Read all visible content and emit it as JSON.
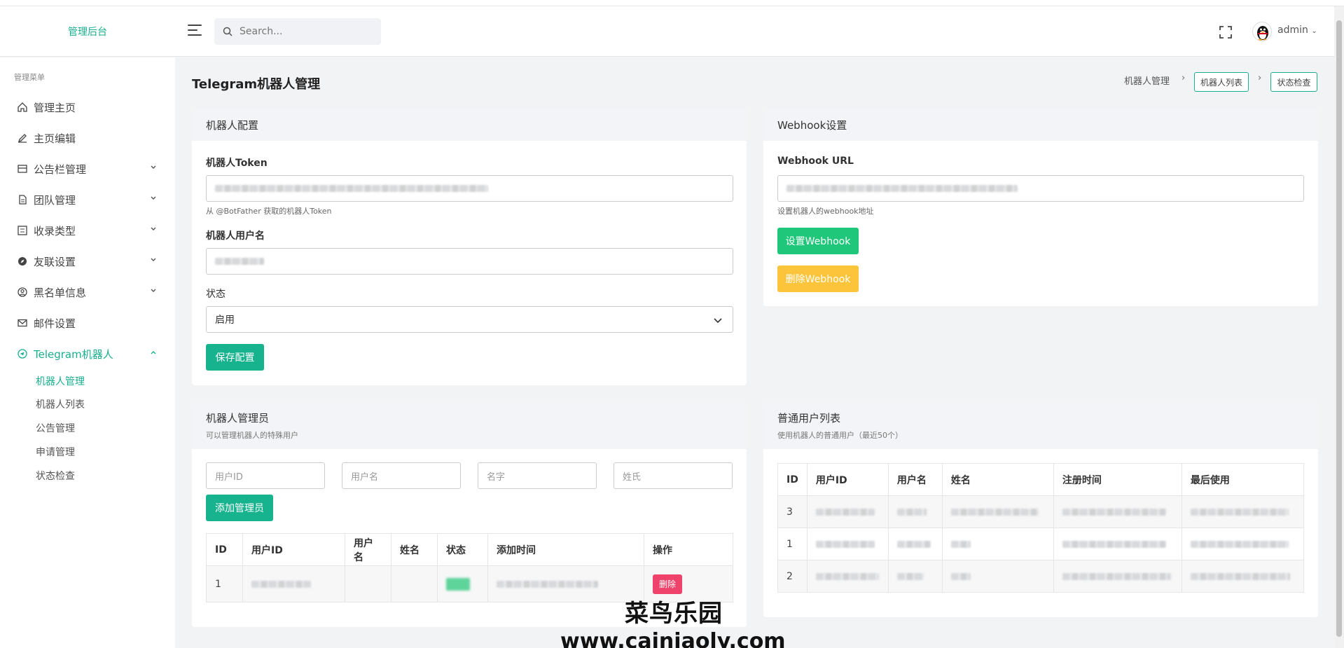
{
  "header": {
    "brand": "管理后台",
    "search_placeholder": "Search...",
    "user": "admin"
  },
  "sidebar": {
    "title": "管理菜单",
    "items": [
      {
        "label": "管理主页",
        "icon": "home-icon"
      },
      {
        "label": "主页编辑",
        "icon": "edit-icon"
      },
      {
        "label": "公告栏管理",
        "icon": "notice-icon"
      },
      {
        "label": "团队管理",
        "icon": "team-icon"
      },
      {
        "label": "收录类型",
        "icon": "category-icon"
      },
      {
        "label": "友联设置",
        "icon": "compass-icon"
      },
      {
        "label": "黑名单信息",
        "icon": "blacklist-icon"
      },
      {
        "label": "邮件设置",
        "icon": "mail-icon"
      },
      {
        "label": "Telegram机器人",
        "icon": "telegram-icon"
      }
    ],
    "sub_items": [
      "机器人管理",
      "机器人列表",
      "公告管理",
      "申请管理",
      "状态检查"
    ]
  },
  "page": {
    "title": "Telegram机器人管理",
    "breadcrumb": {
      "root": "机器人管理",
      "tab1": "机器人列表",
      "tab2": "状态检查"
    }
  },
  "bot_config": {
    "title": "机器人配置",
    "token_label": "机器人Token",
    "token_hint": "从 @BotFather 获取的机器人Token",
    "username_label": "机器人用户名",
    "status_label": "状态",
    "status_value": "启用",
    "save_button": "保存配置"
  },
  "webhook": {
    "title": "Webhook设置",
    "url_label": "Webhook URL",
    "url_hint": "设置机器人的webhook地址",
    "set_button": "设置Webhook",
    "delete_button": "删除Webhook"
  },
  "admins": {
    "title": "机器人管理员",
    "subtitle": "可以管理机器人的特殊用户",
    "placeholders": {
      "user_id": "用户ID",
      "username": "用户名",
      "first_name": "名字",
      "last_name": "姓氏"
    },
    "add_button": "添加管理员",
    "columns": [
      "ID",
      "用户ID",
      "用户名",
      "姓名",
      "状态",
      "添加时间",
      "操作"
    ],
    "rows": [
      {
        "id": "1",
        "delete": "删除"
      }
    ]
  },
  "users": {
    "title": "普通用户列表",
    "subtitle": "使用机器人的普通用户（最近50个）",
    "columns": [
      "ID",
      "用户ID",
      "用户名",
      "姓名",
      "注册时间",
      "最后使用"
    ],
    "rows": [
      {
        "id": "3"
      },
      {
        "id": "1"
      },
      {
        "id": "2"
      }
    ]
  },
  "watermark": {
    "line1": "菜鸟乐园",
    "line2": "www.cainiaoly.com"
  },
  "colors": {
    "accent": "#1aae8f",
    "green": "#1ec77a",
    "yellow": "#fbc43a",
    "red": "#f0436b"
  }
}
